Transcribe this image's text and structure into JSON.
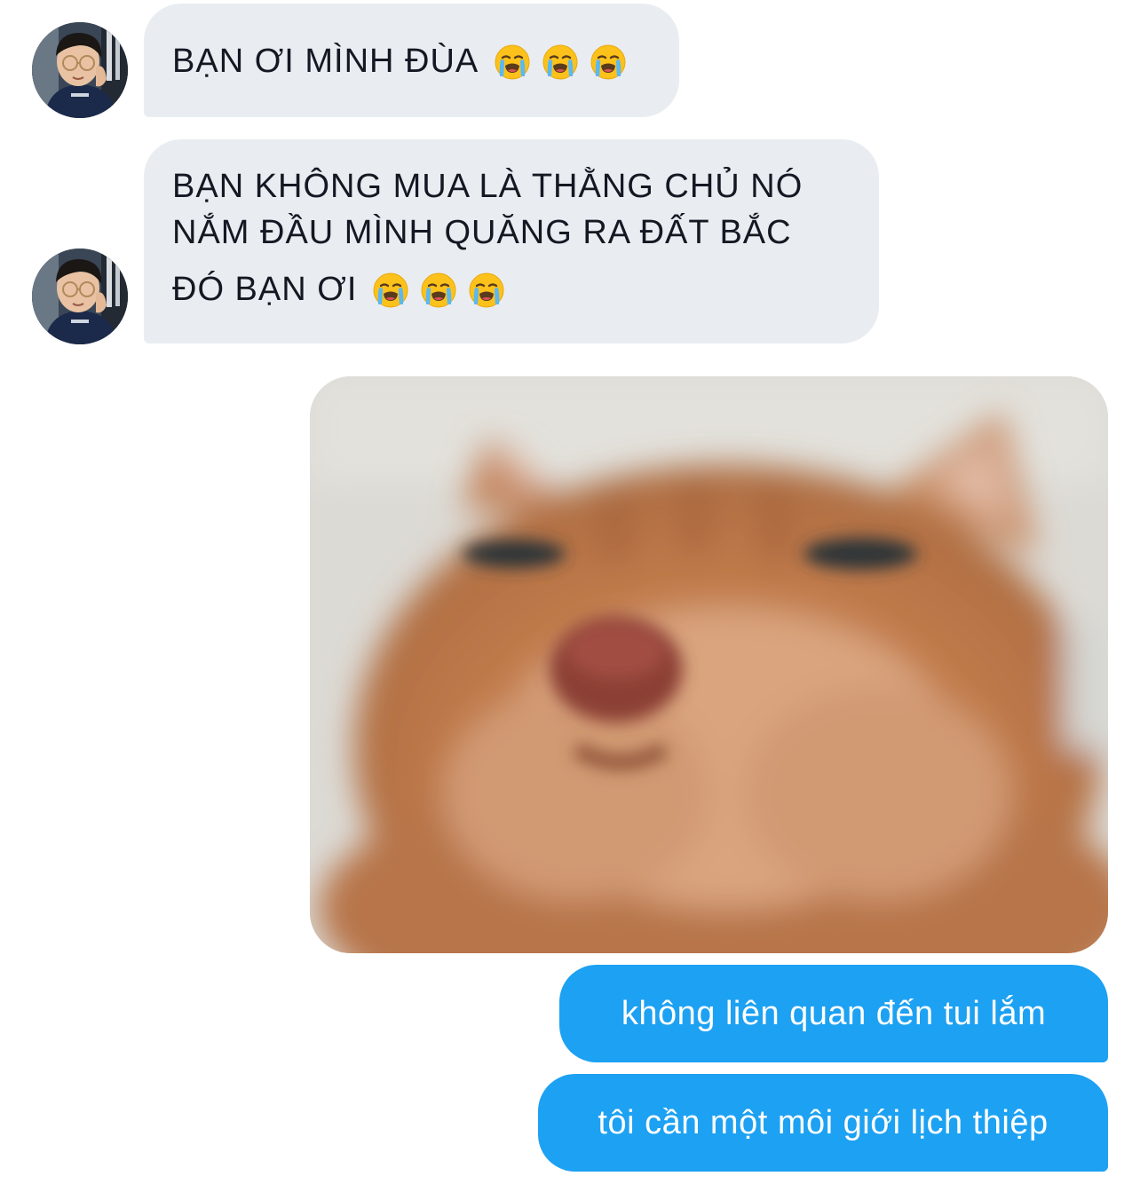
{
  "messages": {
    "received": [
      {
        "lines": [
          "BẠN ƠI MÌNH ĐÙA"
        ],
        "emoji": [
          "crying-face",
          "crying-face",
          "crying-face"
        ]
      },
      {
        "lines": [
          "BẠN KHÔNG MUA LÀ THẰNG CHỦ NÓ",
          "NẮM ĐẦU MÌNH QUĂNG RA ĐẤT BẮC",
          "ĐÓ BẠN ƠI"
        ],
        "emoji": [
          "crying-face",
          "crying-face",
          "crying-face"
        ]
      }
    ],
    "image": {
      "subject": "cat-photo"
    },
    "sent": [
      {
        "text": "không liên quan đến tui lắm"
      },
      {
        "text": "tôi cần một môi giới lịch thiệp"
      }
    ]
  },
  "colors": {
    "received_bubble": "#e9edf1",
    "sent_bubble": "#1da1f2",
    "received_text": "#141823",
    "sent_text": "#ffffff"
  }
}
